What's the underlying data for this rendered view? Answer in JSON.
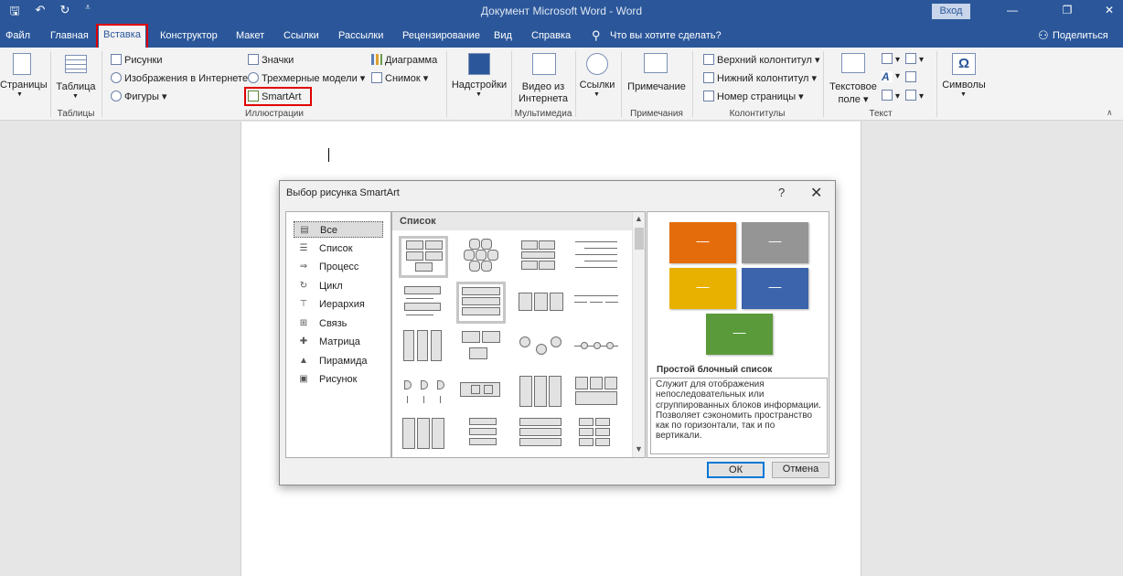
{
  "titlebar": {
    "title": "Документ Microsoft Word  -  Word",
    "login_label": "Вход",
    "save_glyph": "🖫",
    "undo_glyph": "↶",
    "redo_glyph": "↻",
    "qat_more_glyph": "⩡",
    "minimize_glyph": "—",
    "restore_glyph": "❐",
    "close_glyph": "✕"
  },
  "tabs": {
    "file": "Файл",
    "home": "Главная",
    "insert": "Вставка",
    "design": "Конструктор",
    "layout": "Макет",
    "references": "Ссылки",
    "mailings": "Рассылки",
    "review": "Рецензирование",
    "view": "Вид",
    "help": "Справка",
    "tell_me": "Что вы хотите сделать?",
    "share": "Поделиться"
  },
  "ribbon": {
    "pages": "Страницы",
    "table": "Таблица",
    "tables_group": "Таблицы",
    "pictures": "Рисунки",
    "online_pictures": "Изображения в Интернете",
    "shapes": "Фигуры",
    "icons": "Значки",
    "models_3d": "Трехмерные модели",
    "smartart": "SmartArt",
    "chart": "Диаграмма",
    "screenshot": "Снимок",
    "illustrations_group": "Иллюстрации",
    "addins": "Надстройки",
    "online_video_1": "Видео из",
    "online_video_2": "Интернета",
    "media_group": "Мультимедиа",
    "links": "Ссылки",
    "comment": "Примечание",
    "comments_group": "Примечания",
    "header": "Верхний колонтитул",
    "footer": "Нижний колонтитул",
    "page_number": "Номер страницы",
    "header_footer_group": "Колонтитулы",
    "textbox_1": "Текстовое",
    "textbox_2": "поле",
    "text_group": "Текст",
    "symbols": "Символы",
    "symbols_glyph": "Ω"
  },
  "dialog": {
    "title": "Выбор рисунка SmartArt",
    "help_glyph": "?",
    "close_glyph": "✕",
    "categories": [
      {
        "label": "Все",
        "icon": "all-icon"
      },
      {
        "label": "Список",
        "icon": "list-icon"
      },
      {
        "label": "Процесс",
        "icon": "process-icon"
      },
      {
        "label": "Цикл",
        "icon": "cycle-icon"
      },
      {
        "label": "Иерархия",
        "icon": "hierarchy-icon"
      },
      {
        "label": "Связь",
        "icon": "relationship-icon"
      },
      {
        "label": "Матрица",
        "icon": "matrix-icon"
      },
      {
        "label": "Пирамида",
        "icon": "pyramid-icon"
      },
      {
        "label": "Рисунок",
        "icon": "picture-icon"
      }
    ],
    "gallery_header": "Список",
    "preview_name": "Простой блочный список",
    "preview_description": "Служит для отображения непоследовательных или сгруппированных блоков информации. Позволяет сэкономить пространство как по горизонтали, так и по вертикали.",
    "preview_dash": "—",
    "preview_colors": [
      "#e46c0a",
      "#959595",
      "#e8b100",
      "#3b64ad",
      "#5a9a3a"
    ],
    "ok_label": "ОК",
    "cancel_label": "Отмена"
  }
}
